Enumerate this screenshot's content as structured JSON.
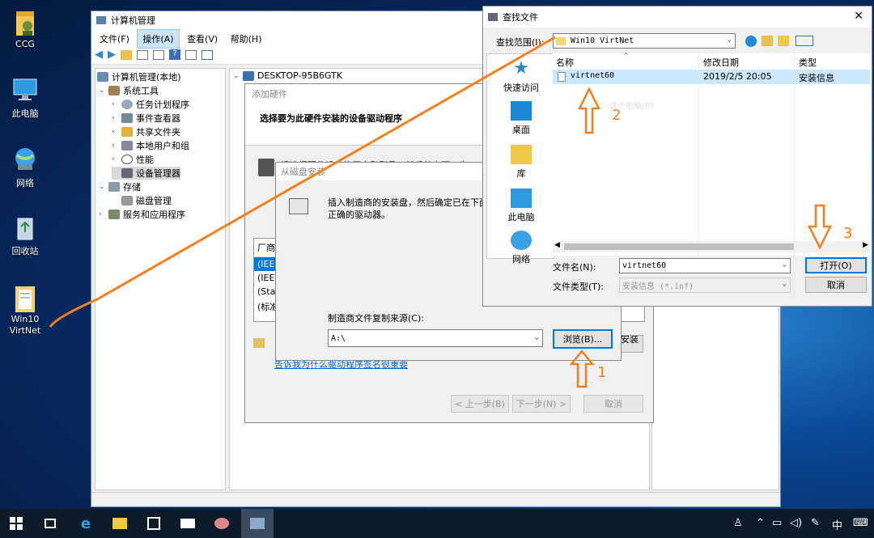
{
  "desktop": {
    "icons": [
      {
        "label": "CCG",
        "icon": "user-folder-icon"
      },
      {
        "label": "此电脑",
        "icon": "this-pc-icon"
      },
      {
        "label": "网络",
        "icon": "network-icon"
      },
      {
        "label": "回收站",
        "icon": "recycle-bin-icon"
      },
      {
        "label": "Win10\nVirtNet",
        "icon": "folder-icon"
      }
    ]
  },
  "computer_mgmt": {
    "title": "计算机管理",
    "menu": [
      "文件(F)",
      "操作(A)",
      "查看(V)",
      "帮助(H)"
    ],
    "tree": {
      "root": "计算机管理(本地)",
      "system_tools": "系统工具",
      "task_scheduler": "任务计划程序",
      "event_viewer": "事件查看器",
      "shared_folders": "共享文件夹",
      "local_users": "本地用户和组",
      "performance": "性能",
      "device_manager": "设备管理器",
      "storage": "存储",
      "disk_management": "磁盘管理",
      "services_apps": "服务和应用程序"
    },
    "device_root": "DESKTOP-95B6GTK"
  },
  "add_hardware": {
    "title": "添加硬件",
    "heading": "选择要为此硬件安装的设备驱动程序",
    "partial_text": "请选择硬件设备的厂商和型号，然后单击下一步",
    "list_header": "厂商",
    "list_items": [
      "(IEEE",
      "(IEEE",
      "(Stan",
      "(标准"
    ],
    "link": "告诉我为什么驱动程序签名很重要",
    "back": "< 上一步(B)",
    "next": "下一步(N) >",
    "cancel": "取消",
    "side_btn": "从磁盘安装(H)..."
  },
  "install_from_disk": {
    "title": "从磁盘安装",
    "message": "插入制造商的安装盘，然后确定已在下面选定正确的驱动器。",
    "source_label": "制造商文件复制来源(C):",
    "source_value": "A:\\",
    "browse": "浏览(B)..."
  },
  "find_file": {
    "title": "查找文件",
    "look_in_label": "查找范围(I):",
    "look_in_value": "Win10 VirtNet",
    "places": [
      "快速访问",
      "桌面",
      "库",
      "此电脑",
      "网络"
    ],
    "columns": [
      "名称",
      "修改日期",
      "类型"
    ],
    "file": {
      "name": "virtnet60",
      "date": "2019/2/5 20:05",
      "type": "安装信息"
    },
    "ghost_text": "这个电脑(R)",
    "filename_label": "文件名(N):",
    "filename_value": "virtnet60",
    "filetype_label": "文件类型(T):",
    "filetype_value": "安装信息 (*.inf)",
    "open": "打开(O)",
    "cancel": "取消"
  },
  "annotations": {
    "step1": "1",
    "step2": "2",
    "step3": "3",
    "color": "#f08020"
  },
  "taskbar": {
    "tray": {
      "ime": "中",
      "lang_icon": "keyboard-icon"
    }
  }
}
